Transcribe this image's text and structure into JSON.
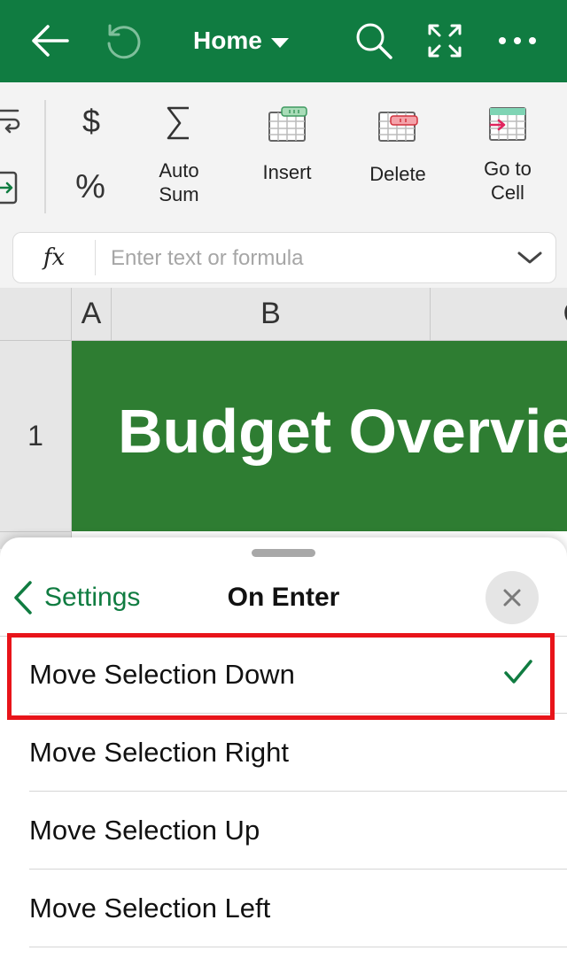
{
  "toolbar": {
    "title": "Home",
    "icons": [
      "back-arrow-icon",
      "undo-icon",
      "search-icon",
      "fullscreen-icon",
      "more-icon"
    ]
  },
  "ribbon": {
    "currency_symbol": "$",
    "percent_symbol": "%",
    "autosum_label": "Auto\nSum",
    "insert_label": "Insert",
    "delete_label": "Delete",
    "goto_label": "Go to\nCell"
  },
  "formula_bar": {
    "fx_label": "fx",
    "placeholder": "Enter text or formula",
    "value": ""
  },
  "sheet": {
    "columns": [
      "A",
      "B",
      "C"
    ],
    "rows": [
      "1"
    ],
    "cell_b1": "Budget Overview",
    "title_fill_color": "#2e7d32"
  },
  "panel": {
    "back_label": "Settings",
    "title": "On Enter",
    "options": [
      "Move Selection Down",
      "Move Selection Right",
      "Move Selection Up",
      "Move Selection Left"
    ],
    "selected_option": "Move Selection Down"
  },
  "colors": {
    "brand": "#107c41",
    "highlight": "#e8141a"
  }
}
